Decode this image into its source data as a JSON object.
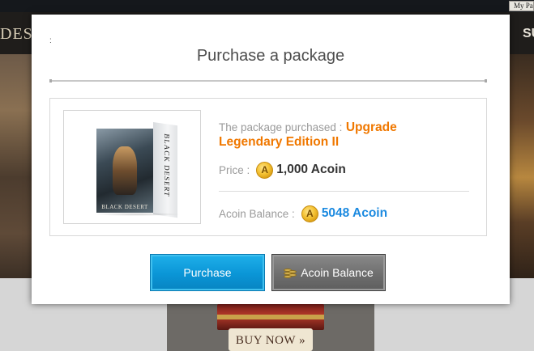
{
  "background": {
    "my_page_label": "My Pa",
    "logo_left": "DESER",
    "logo_right": "SU",
    "buy_now_label": "BUY NOW »"
  },
  "modal": {
    "marker": ":",
    "title": "Purchase a package",
    "product_image_alt": "Black Desert package box",
    "product_box_text": "BLACK DESERT",
    "package_label": "The package purchased :",
    "package_name": "Upgrade Legendary Edition II",
    "price_label": "Price :",
    "price_value": "1,000 Acoin",
    "balance_label": "Acoin Balance :",
    "balance_value": "5048 Acoin",
    "coin_symbol": "A"
  },
  "buttons": {
    "purchase": "Purchase",
    "acoin_balance": "Acoin Balance"
  },
  "colors": {
    "package_name": "#f07800",
    "balance_value": "#1c8ae0",
    "purchase_button": "#0a95d6",
    "balance_button": "#6e6e6e"
  },
  "icons": {
    "coin": "acoin-coin-icon",
    "balance_button": "coin-stack-icon"
  }
}
